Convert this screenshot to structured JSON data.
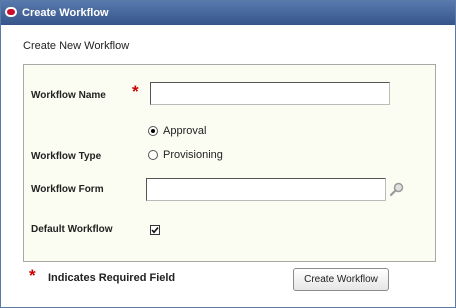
{
  "window": {
    "title": "Create Workflow",
    "logo_icon": "oracle-logo-icon"
  },
  "form": {
    "subtitle": "Create New Workflow",
    "workflow_name": {
      "label": "Workflow Name",
      "value": "",
      "required": true
    },
    "workflow_type": {
      "label": "Workflow Type",
      "options": [
        {
          "label": "Approval",
          "selected": true
        },
        {
          "label": "Provisioning",
          "selected": false
        }
      ]
    },
    "workflow_form": {
      "label": "Workflow Form",
      "value": "",
      "lookup_icon": "search-icon"
    },
    "default_workflow": {
      "label": "Default Workflow",
      "checked": true
    }
  },
  "footer": {
    "required_note": "Indicates Required Field",
    "required_marker": "*",
    "submit_label": "Create Workflow"
  },
  "colors": {
    "title_bar": "#3f609a",
    "panel_background": "#fbfdf2",
    "required_star": "#cc0000"
  }
}
